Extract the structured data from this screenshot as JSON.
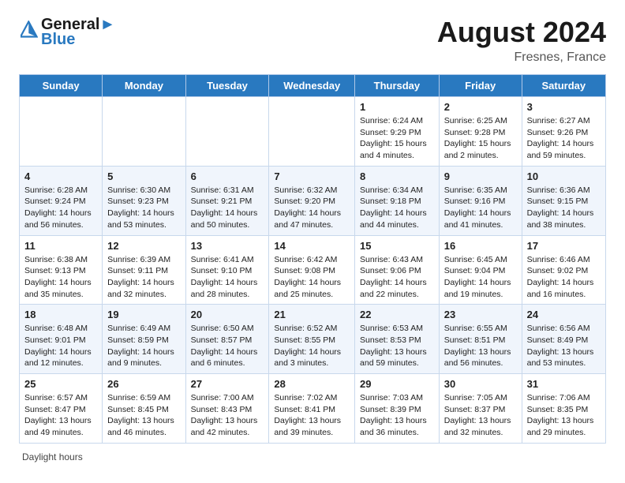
{
  "header": {
    "logo_line1": "General",
    "logo_line2": "Blue",
    "month_title": "August 2024",
    "location": "Fresnes, France"
  },
  "days_of_week": [
    "Sunday",
    "Monday",
    "Tuesday",
    "Wednesday",
    "Thursday",
    "Friday",
    "Saturday"
  ],
  "weeks": [
    [
      {
        "day": "",
        "info": ""
      },
      {
        "day": "",
        "info": ""
      },
      {
        "day": "",
        "info": ""
      },
      {
        "day": "",
        "info": ""
      },
      {
        "day": "1",
        "info": "Sunrise: 6:24 AM\nSunset: 9:29 PM\nDaylight: 15 hours\nand 4 minutes."
      },
      {
        "day": "2",
        "info": "Sunrise: 6:25 AM\nSunset: 9:28 PM\nDaylight: 15 hours\nand 2 minutes."
      },
      {
        "day": "3",
        "info": "Sunrise: 6:27 AM\nSunset: 9:26 PM\nDaylight: 14 hours\nand 59 minutes."
      }
    ],
    [
      {
        "day": "4",
        "info": "Sunrise: 6:28 AM\nSunset: 9:24 PM\nDaylight: 14 hours\nand 56 minutes."
      },
      {
        "day": "5",
        "info": "Sunrise: 6:30 AM\nSunset: 9:23 PM\nDaylight: 14 hours\nand 53 minutes."
      },
      {
        "day": "6",
        "info": "Sunrise: 6:31 AM\nSunset: 9:21 PM\nDaylight: 14 hours\nand 50 minutes."
      },
      {
        "day": "7",
        "info": "Sunrise: 6:32 AM\nSunset: 9:20 PM\nDaylight: 14 hours\nand 47 minutes."
      },
      {
        "day": "8",
        "info": "Sunrise: 6:34 AM\nSunset: 9:18 PM\nDaylight: 14 hours\nand 44 minutes."
      },
      {
        "day": "9",
        "info": "Sunrise: 6:35 AM\nSunset: 9:16 PM\nDaylight: 14 hours\nand 41 minutes."
      },
      {
        "day": "10",
        "info": "Sunrise: 6:36 AM\nSunset: 9:15 PM\nDaylight: 14 hours\nand 38 minutes."
      }
    ],
    [
      {
        "day": "11",
        "info": "Sunrise: 6:38 AM\nSunset: 9:13 PM\nDaylight: 14 hours\nand 35 minutes."
      },
      {
        "day": "12",
        "info": "Sunrise: 6:39 AM\nSunset: 9:11 PM\nDaylight: 14 hours\nand 32 minutes."
      },
      {
        "day": "13",
        "info": "Sunrise: 6:41 AM\nSunset: 9:10 PM\nDaylight: 14 hours\nand 28 minutes."
      },
      {
        "day": "14",
        "info": "Sunrise: 6:42 AM\nSunset: 9:08 PM\nDaylight: 14 hours\nand 25 minutes."
      },
      {
        "day": "15",
        "info": "Sunrise: 6:43 AM\nSunset: 9:06 PM\nDaylight: 14 hours\nand 22 minutes."
      },
      {
        "day": "16",
        "info": "Sunrise: 6:45 AM\nSunset: 9:04 PM\nDaylight: 14 hours\nand 19 minutes."
      },
      {
        "day": "17",
        "info": "Sunrise: 6:46 AM\nSunset: 9:02 PM\nDaylight: 14 hours\nand 16 minutes."
      }
    ],
    [
      {
        "day": "18",
        "info": "Sunrise: 6:48 AM\nSunset: 9:01 PM\nDaylight: 14 hours\nand 12 minutes."
      },
      {
        "day": "19",
        "info": "Sunrise: 6:49 AM\nSunset: 8:59 PM\nDaylight: 14 hours\nand 9 minutes."
      },
      {
        "day": "20",
        "info": "Sunrise: 6:50 AM\nSunset: 8:57 PM\nDaylight: 14 hours\nand 6 minutes."
      },
      {
        "day": "21",
        "info": "Sunrise: 6:52 AM\nSunset: 8:55 PM\nDaylight: 14 hours\nand 3 minutes."
      },
      {
        "day": "22",
        "info": "Sunrise: 6:53 AM\nSunset: 8:53 PM\nDaylight: 13 hours\nand 59 minutes."
      },
      {
        "day": "23",
        "info": "Sunrise: 6:55 AM\nSunset: 8:51 PM\nDaylight: 13 hours\nand 56 minutes."
      },
      {
        "day": "24",
        "info": "Sunrise: 6:56 AM\nSunset: 8:49 PM\nDaylight: 13 hours\nand 53 minutes."
      }
    ],
    [
      {
        "day": "25",
        "info": "Sunrise: 6:57 AM\nSunset: 8:47 PM\nDaylight: 13 hours\nand 49 minutes."
      },
      {
        "day": "26",
        "info": "Sunrise: 6:59 AM\nSunset: 8:45 PM\nDaylight: 13 hours\nand 46 minutes."
      },
      {
        "day": "27",
        "info": "Sunrise: 7:00 AM\nSunset: 8:43 PM\nDaylight: 13 hours\nand 42 minutes."
      },
      {
        "day": "28",
        "info": "Sunrise: 7:02 AM\nSunset: 8:41 PM\nDaylight: 13 hours\nand 39 minutes."
      },
      {
        "day": "29",
        "info": "Sunrise: 7:03 AM\nSunset: 8:39 PM\nDaylight: 13 hours\nand 36 minutes."
      },
      {
        "day": "30",
        "info": "Sunrise: 7:05 AM\nSunset: 8:37 PM\nDaylight: 13 hours\nand 32 minutes."
      },
      {
        "day": "31",
        "info": "Sunrise: 7:06 AM\nSunset: 8:35 PM\nDaylight: 13 hours\nand 29 minutes."
      }
    ]
  ],
  "footer": {
    "label": "Daylight hours"
  }
}
